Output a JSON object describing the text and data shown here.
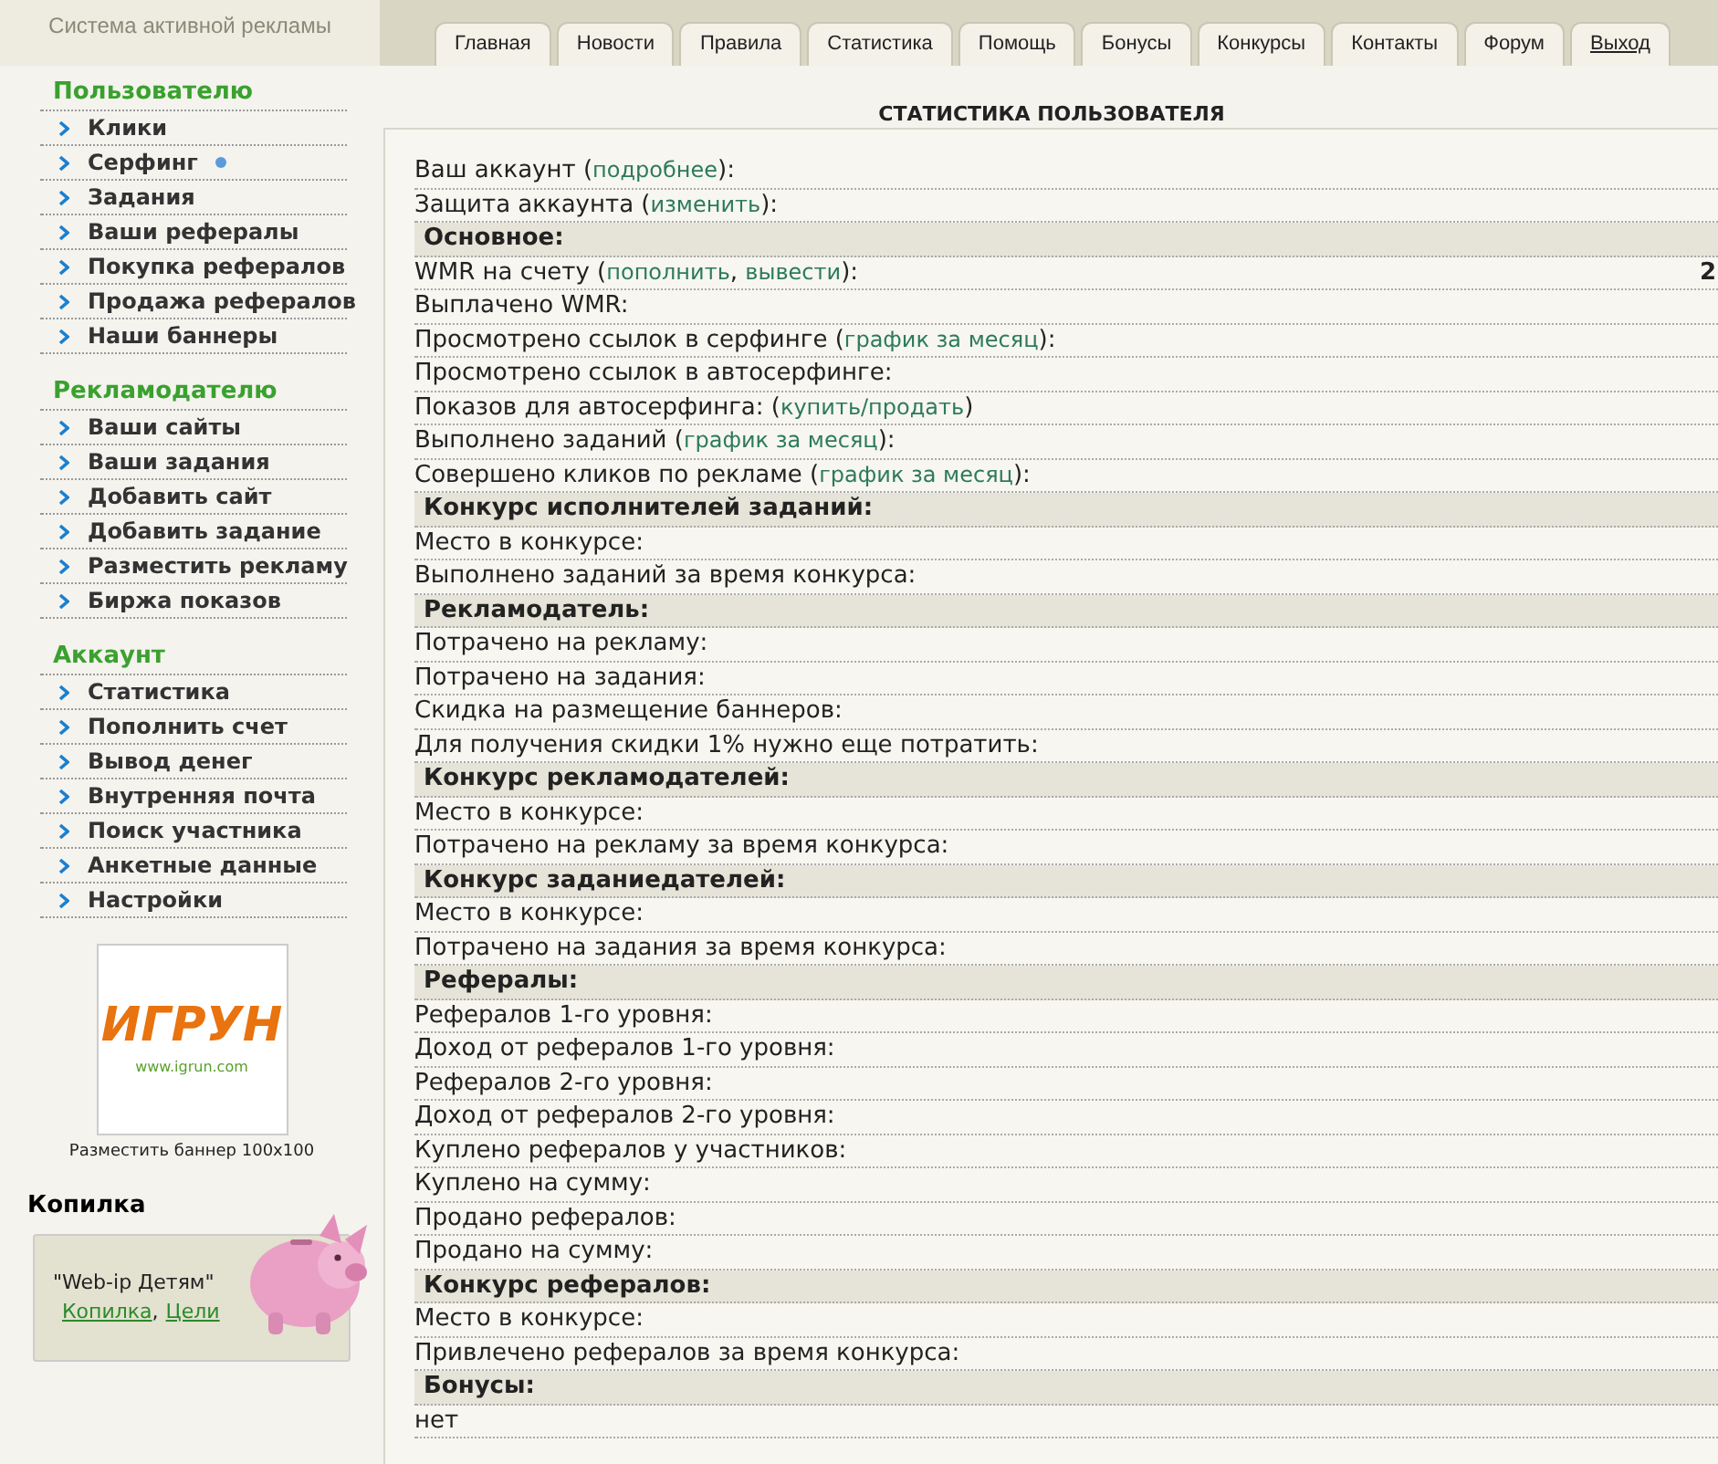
{
  "site_title": "Система активной рекламы",
  "tabs": [
    {
      "label": "Главная",
      "kind": "tab"
    },
    {
      "label": "Новости",
      "kind": "tab"
    },
    {
      "label": "Правила",
      "kind": "tab"
    },
    {
      "label": "Статистика",
      "kind": "tab"
    },
    {
      "label": "Помощь",
      "kind": "tab"
    },
    {
      "label": "Бонусы",
      "kind": "tab"
    },
    {
      "label": "Конкурсы",
      "kind": "tab"
    },
    {
      "label": "Контакты",
      "kind": "tab"
    },
    {
      "label": "Форум",
      "kind": "tab"
    },
    {
      "label": "Выход",
      "kind": "logout"
    }
  ],
  "sidebar": [
    {
      "heading": "Пользователю",
      "items": [
        {
          "label": "Клики",
          "new": false
        },
        {
          "label": "Серфинг",
          "new": true
        },
        {
          "label": "Задания",
          "new": false
        },
        {
          "label": "Ваши рефералы",
          "new": false
        },
        {
          "label": "Покупка рефералов",
          "new": false
        },
        {
          "label": "Продажа рефералов",
          "new": false
        },
        {
          "label": "Наши баннеры",
          "new": false
        }
      ]
    },
    {
      "heading": "Рекламодателю",
      "items": [
        {
          "label": "Ваши сайты",
          "new": false
        },
        {
          "label": "Ваши задания",
          "new": false
        },
        {
          "label": "Добавить сайт",
          "new": false
        },
        {
          "label": "Добавить задание",
          "new": false
        },
        {
          "label": "Разместить рекламу",
          "new": false
        },
        {
          "label": "Биржа показов",
          "new": false
        }
      ]
    },
    {
      "heading": "Аккаунт",
      "items": [
        {
          "label": "Статистика",
          "new": false
        },
        {
          "label": "Пополнить счет",
          "new": false
        },
        {
          "label": "Вывод денег",
          "new": false
        },
        {
          "label": "Внутренняя почта",
          "new": false
        },
        {
          "label": "Поиск участника",
          "new": false
        },
        {
          "label": "Анкетные данные",
          "new": false
        },
        {
          "label": "Настройки",
          "new": false
        }
      ]
    }
  ],
  "banner": {
    "logo_text": "ИГРУН",
    "logo_url": "www.igrun.com",
    "caption": "Разместить баннер 100x100"
  },
  "piggy": {
    "title": "Копилка",
    "name": "\"Web-ip Детям\"",
    "links": [
      "Копилка",
      "Цели"
    ],
    "separator": ","
  },
  "stats": {
    "title": "СТАТИСТИКА ПОЛЬЗОВАТЕЛЯ",
    "rows": [
      {
        "kind": "row",
        "parts": [
          {
            "kind": "text",
            "text": "Ваш аккаунт ("
          },
          {
            "kind": "link",
            "text": "подробнее"
          },
          {
            "kind": "text",
            "text": "):"
          }
        ]
      },
      {
        "kind": "row",
        "parts": [
          {
            "kind": "text",
            "text": "Защита аккаунта ("
          },
          {
            "kind": "link",
            "text": "изменить"
          },
          {
            "kind": "text",
            "text": "):"
          }
        ]
      },
      {
        "kind": "section",
        "parts": [
          {
            "kind": "text",
            "text": "Основное:"
          }
        ]
      },
      {
        "kind": "row",
        "parts": [
          {
            "kind": "text",
            "text": "WMR на счету ("
          },
          {
            "kind": "link",
            "text": "пополнить"
          },
          {
            "kind": "text",
            "text": ", "
          },
          {
            "kind": "link",
            "text": "вывести"
          },
          {
            "kind": "text",
            "text": "):"
          }
        ],
        "value": "2"
      },
      {
        "kind": "row",
        "parts": [
          {
            "kind": "text",
            "text": "Выплачено WMR:"
          }
        ]
      },
      {
        "kind": "row",
        "parts": [
          {
            "kind": "text",
            "text": "Просмотрено ссылок в серфинге ("
          },
          {
            "kind": "link",
            "text": "график за месяц"
          },
          {
            "kind": "text",
            "text": "):"
          }
        ]
      },
      {
        "kind": "row",
        "parts": [
          {
            "kind": "text",
            "text": "Просмотрено ссылок в автосерфинге:"
          }
        ]
      },
      {
        "kind": "row",
        "parts": [
          {
            "kind": "text",
            "text": "Показов для автосерфинга: ("
          },
          {
            "kind": "link",
            "text": "купить/продать"
          },
          {
            "kind": "text",
            "text": ")"
          }
        ]
      },
      {
        "kind": "row",
        "parts": [
          {
            "kind": "text",
            "text": "Выполнено заданий ("
          },
          {
            "kind": "link",
            "text": "график за месяц"
          },
          {
            "kind": "text",
            "text": "):"
          }
        ]
      },
      {
        "kind": "row",
        "parts": [
          {
            "kind": "text",
            "text": "Совершено кликов по рекламе ("
          },
          {
            "kind": "link",
            "text": "график за месяц"
          },
          {
            "kind": "text",
            "text": "):"
          }
        ]
      },
      {
        "kind": "section",
        "parts": [
          {
            "kind": "text",
            "text": "Конкурс исполнителей заданий:"
          }
        ]
      },
      {
        "kind": "row",
        "parts": [
          {
            "kind": "text",
            "text": "Место в конкурсе:"
          }
        ]
      },
      {
        "kind": "row",
        "parts": [
          {
            "kind": "text",
            "text": "Выполнено заданий за время конкурса:"
          }
        ]
      },
      {
        "kind": "section",
        "parts": [
          {
            "kind": "text",
            "text": "Рекламодатель:"
          }
        ]
      },
      {
        "kind": "row",
        "parts": [
          {
            "kind": "text",
            "text": "Потрачено на рекламу:"
          }
        ]
      },
      {
        "kind": "row",
        "parts": [
          {
            "kind": "text",
            "text": "Потрачено на задания:"
          }
        ]
      },
      {
        "kind": "row",
        "parts": [
          {
            "kind": "text",
            "text": "Скидка на размещение баннеров:"
          }
        ]
      },
      {
        "kind": "row",
        "parts": [
          {
            "kind": "text",
            "text": "Для получения скидки 1% нужно еще потратить:"
          }
        ]
      },
      {
        "kind": "section",
        "parts": [
          {
            "kind": "text",
            "text": "Конкурс рекламодателей:"
          }
        ]
      },
      {
        "kind": "row",
        "parts": [
          {
            "kind": "text",
            "text": "Место в конкурсе:"
          }
        ]
      },
      {
        "kind": "row",
        "parts": [
          {
            "kind": "text",
            "text": "Потрачено на рекламу за время конкурса:"
          }
        ]
      },
      {
        "kind": "section",
        "parts": [
          {
            "kind": "text",
            "text": "Конкурс заданиедателей:"
          }
        ]
      },
      {
        "kind": "row",
        "parts": [
          {
            "kind": "text",
            "text": "Место в конкурсе:"
          }
        ]
      },
      {
        "kind": "row",
        "parts": [
          {
            "kind": "text",
            "text": "Потрачено на задания за время конкурса:"
          }
        ]
      },
      {
        "kind": "section",
        "parts": [
          {
            "kind": "text",
            "text": "Рефералы:"
          }
        ]
      },
      {
        "kind": "row",
        "parts": [
          {
            "kind": "text",
            "text": "Рефералов 1-го уровня:"
          }
        ]
      },
      {
        "kind": "row",
        "parts": [
          {
            "kind": "text",
            "text": "Доход от рефералов 1-го уровня:"
          }
        ]
      },
      {
        "kind": "row",
        "parts": [
          {
            "kind": "text",
            "text": "Рефералов 2-го уровня:"
          }
        ]
      },
      {
        "kind": "row",
        "parts": [
          {
            "kind": "text",
            "text": "Доход от рефералов 2-го уровня:"
          }
        ]
      },
      {
        "kind": "row",
        "parts": [
          {
            "kind": "text",
            "text": "Куплено рефералов у участников:"
          }
        ]
      },
      {
        "kind": "row",
        "parts": [
          {
            "kind": "text",
            "text": "Куплено на сумму:"
          }
        ]
      },
      {
        "kind": "row",
        "parts": [
          {
            "kind": "text",
            "text": "Продано рефералов:"
          }
        ]
      },
      {
        "kind": "row",
        "parts": [
          {
            "kind": "text",
            "text": "Продано на сумму:"
          }
        ]
      },
      {
        "kind": "section",
        "parts": [
          {
            "kind": "text",
            "text": "Конкурс рефералов:"
          }
        ]
      },
      {
        "kind": "row",
        "parts": [
          {
            "kind": "text",
            "text": "Место в конкурсе:"
          }
        ]
      },
      {
        "kind": "row",
        "parts": [
          {
            "kind": "text",
            "text": "Привлечено рефералов за время конкурса:"
          }
        ]
      },
      {
        "kind": "section",
        "parts": [
          {
            "kind": "text",
            "text": "Бонусы:"
          }
        ]
      },
      {
        "kind": "row",
        "parts": [
          {
            "kind": "text",
            "text": "нет"
          }
        ]
      }
    ]
  }
}
